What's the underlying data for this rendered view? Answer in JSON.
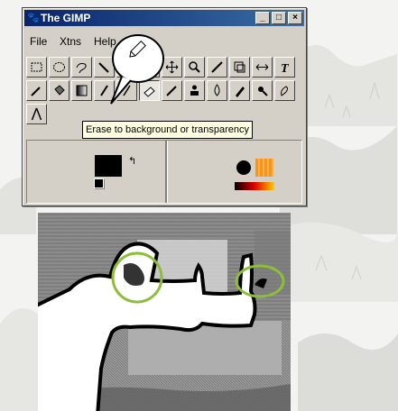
{
  "window": {
    "title": "The GIMP",
    "controls": [
      "_",
      "□",
      "×"
    ]
  },
  "menu": [
    "File",
    "Xtns",
    "Help"
  ],
  "tools_row1": [
    "rect-select",
    "ellipse-select",
    "lasso",
    "magic-wand",
    "pencil",
    "bezier-select",
    "move",
    "zoom",
    "crop",
    "transform",
    "flip",
    "text"
  ],
  "tools_row2": [
    "color-picker",
    "bucket-fill",
    "gradient",
    "pencil",
    "paintbrush",
    "eraser",
    "airbrush",
    "clone",
    "blur",
    "ink",
    "dodge-burn",
    "smudge"
  ],
  "tools_row3": [
    "measure"
  ],
  "active_tool": "eraser",
  "tooltip": "Erase to background or transparency",
  "colors": {
    "foreground": "#000000",
    "background": "#ffffff",
    "highlight": "#8dbe3a",
    "accent": "#f7931e"
  }
}
